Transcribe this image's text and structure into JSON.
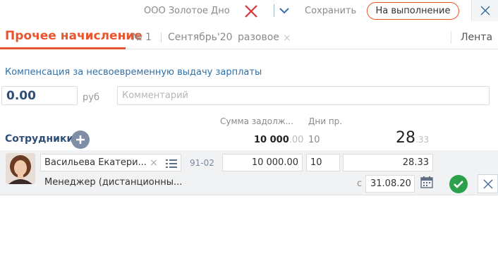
{
  "topbar": {
    "company": "ООО Золотое Дно",
    "save_label": "Сохранить",
    "run_button": "На выполнение"
  },
  "header": {
    "title": "Прочее начисление",
    "number": "№ 1",
    "period": "Сентябрь'20",
    "kind": "разовое",
    "kind_clear": "×",
    "feed": "Лента"
  },
  "form": {
    "compensation_title": "Компенсация за несвоевременную выдачу зарплаты",
    "amount": "0.00",
    "currency": "руб",
    "comment_placeholder": "Комментарий"
  },
  "columns": {
    "debt": "Сумма задолж...",
    "days": "Дни пр."
  },
  "employees_section": {
    "label": "Сотрудники",
    "total_debt_int": "10 000",
    "total_debt_dec": ".00",
    "total_days": "10",
    "total_sum_int": "28",
    "total_sum_dec": ".33"
  },
  "employee": {
    "name": "Васильева Екатери...",
    "name_clear": "×",
    "code": "91-02",
    "debt": "10 000.00",
    "days": "10",
    "sum": "28.33",
    "position": "Менеджер (дистанционны...",
    "from_label": "с",
    "from_date": "31.08.20"
  },
  "colors": {
    "accent": "#e8562f",
    "link": "#2f70a8",
    "ok": "#2ba14c"
  }
}
